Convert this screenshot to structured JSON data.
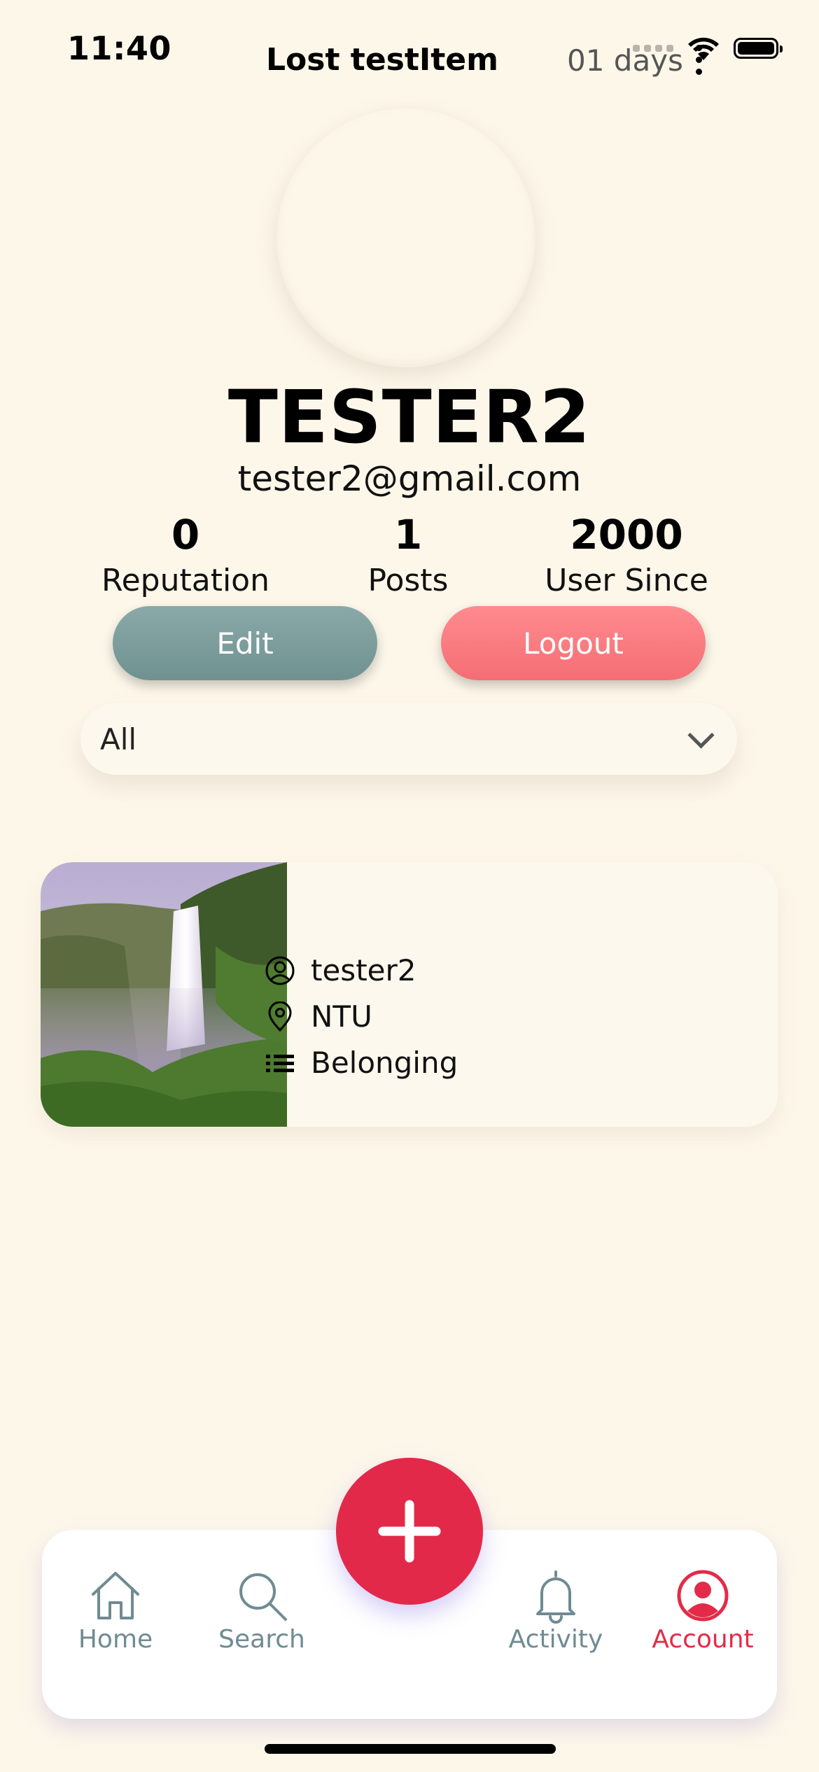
{
  "status_bar": {
    "time": "11:40"
  },
  "profile": {
    "name": "TESTER2",
    "email": "tester2@gmail.com",
    "stats": [
      {
        "value": "0",
        "label": "Reputation"
      },
      {
        "value": "1",
        "label": "Posts"
      },
      {
        "value": "2000",
        "label": "User Since"
      }
    ]
  },
  "actions": {
    "edit_label": "Edit",
    "logout_label": "Logout"
  },
  "filter": {
    "selected": "All"
  },
  "posts": [
    {
      "title": "Lost testItem",
      "time": "01 days",
      "user": "tester2",
      "location": "NTU",
      "category": "Belonging"
    }
  ],
  "tabs": [
    {
      "label": "Home",
      "icon": "home-icon"
    },
    {
      "label": "Search",
      "icon": "search-icon"
    },
    {
      "label": "Activity",
      "icon": "bell-icon"
    },
    {
      "label": "Account",
      "icon": "account-icon"
    }
  ],
  "colors": {
    "background": "#fdf7ea",
    "accent": "#e3294a",
    "edit_button": "#7c9e9d",
    "logout_button": "#f87b80",
    "tab_inactive": "#6f8b93"
  }
}
